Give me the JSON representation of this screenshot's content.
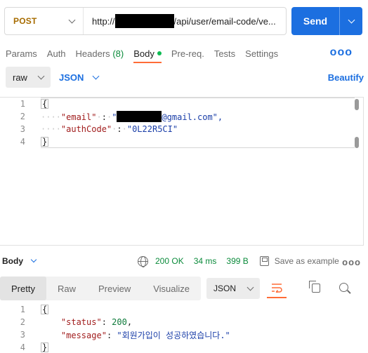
{
  "request": {
    "method": "POST",
    "url_prefix": "http://",
    "url_suffix": "/api/user/email-code/ve...",
    "send_label": "Send"
  },
  "tabs": [
    {
      "label": "Params"
    },
    {
      "label": "Auth"
    },
    {
      "label": "Headers",
      "count": "(8)"
    },
    {
      "label": "Body"
    },
    {
      "label": "Pre-req."
    },
    {
      "label": "Tests"
    },
    {
      "label": "Settings"
    }
  ],
  "more_label": "ooo",
  "body_options": {
    "mode": "raw",
    "language": "JSON",
    "beautify_label": "Beautify"
  },
  "request_body": {
    "line_numbers": [
      "1",
      "2",
      "3",
      "4"
    ],
    "open_brace": "{",
    "close_brace": "}",
    "email_key": "\"email\"",
    "email_value_suffix": "@gmail.com\",",
    "auth_key": "\"authCode\"",
    "auth_value": "\"0L22R5CI\"",
    "colon": ":",
    "dots": "····"
  },
  "response_meta": {
    "body_label": "Body",
    "status": "200 OK",
    "time": "34 ms",
    "size": "399 B",
    "save_label": "Save as example",
    "more_label": "ooo"
  },
  "response_toolbar": {
    "view_tabs": [
      "Pretty",
      "Raw",
      "Preview",
      "Visualize"
    ],
    "format": "JSON"
  },
  "response_body": {
    "line_numbers": [
      "1",
      "2",
      "3",
      "4"
    ],
    "open_brace": "{",
    "close_brace": "}",
    "status_key": "\"status\"",
    "status_value": "200",
    "message_key": "\"message\"",
    "message_value": "\"회원가입이 성공하였습니다.\""
  },
  "colors": {
    "accent": "#1c6fe0",
    "method": "#a76c00",
    "active_tab": "#ff6c37",
    "success": "#0b8b3b"
  }
}
